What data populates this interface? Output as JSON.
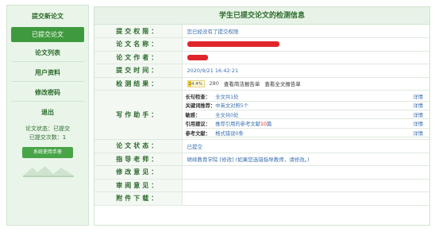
{
  "sidebar": {
    "items": [
      {
        "label": "提交新论文"
      },
      {
        "label": "已提交论文"
      },
      {
        "label": "论文列表"
      },
      {
        "label": "用户资料"
      },
      {
        "label": "修改密码"
      },
      {
        "label": "退出"
      }
    ],
    "status_line": "论文状态：已提交",
    "count_line": "已提交次数：1",
    "manual_label": "系统使用手册"
  },
  "main": {
    "title": "学生已提交论文的检测信息",
    "rows": {
      "permission": {
        "label": "提交权限：",
        "value": "您已经没有了提交权限"
      },
      "paper_name": {
        "label": "论文名称："
      },
      "author": {
        "label": "论文作者："
      },
      "submit_time": {
        "label": "提交时间：",
        "value": "2020/9/21 16:42:21"
      },
      "result": {
        "label": "检测结果：",
        "percent_text": "24.4%",
        "percent": 24.4,
        "number": "280",
        "link1": "查看简洁报告单",
        "link2": "查看全文报告单"
      },
      "assistant": {
        "label": "写作助手：",
        "items": [
          {
            "key": "长句检查：",
            "value": "全文共1处",
            "detail": "详情"
          },
          {
            "key": "关键词推荐：",
            "value": "中英文对照5个",
            "detail": "详情"
          },
          {
            "key": "敏感：",
            "value": "全文共0处",
            "detail": "详情"
          },
          {
            "key": "引用建议：",
            "value": "推荐引用的参考文献",
            "value_hl": "10",
            "value_tail": "篇",
            "detail": "详情"
          },
          {
            "key": "参考文献：",
            "value": "格式错误0条",
            "detail": "详情"
          }
        ]
      },
      "paper_status": {
        "label": "论文状态：",
        "value": "已提交"
      },
      "advisor": {
        "label": "指导老师：",
        "value": "继续教育学院  ",
        "value_extra": "(如果您选错指导教师，请修改。)",
        "edit": "[修改]"
      },
      "revision": {
        "label": "修改意见："
      },
      "review": {
        "label": "审阅意见："
      },
      "attachment": {
        "label": "附件下载："
      }
    }
  },
  "colors": {
    "green": "#3f9a3f",
    "red_redaction": "#e0262b",
    "link_blue": "#3a6fb0",
    "progress": "#f4d23c"
  }
}
